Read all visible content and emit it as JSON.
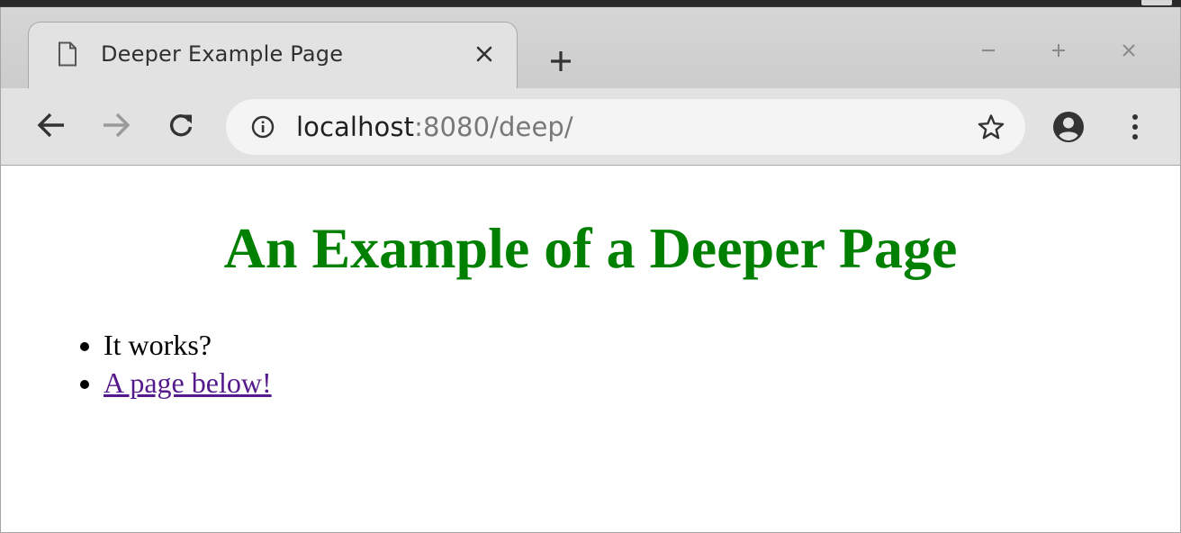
{
  "browser": {
    "tab": {
      "title": "Deeper Example Page",
      "favicon": "document-icon"
    },
    "address_bar": {
      "host": "localhost",
      "rest": ":8080/deep/"
    },
    "icons": {
      "back": "arrow-left-icon",
      "forward": "arrow-right-icon",
      "reload": "reload-icon",
      "info": "info-icon",
      "star": "star-icon",
      "profile": "account-icon",
      "menu": "vertical-ellipsis-icon",
      "new_tab": "plus-icon",
      "close": "close-icon",
      "minimize": "minimize-icon",
      "maximize": "maximize-icon"
    }
  },
  "page": {
    "heading": "An Example of a Deeper Page",
    "items": [
      {
        "text": "It works?",
        "link": false
      },
      {
        "text": "A page below!",
        "link": true
      }
    ]
  },
  "colors": {
    "heading": "#008000",
    "visited_link": "#551a8b"
  }
}
